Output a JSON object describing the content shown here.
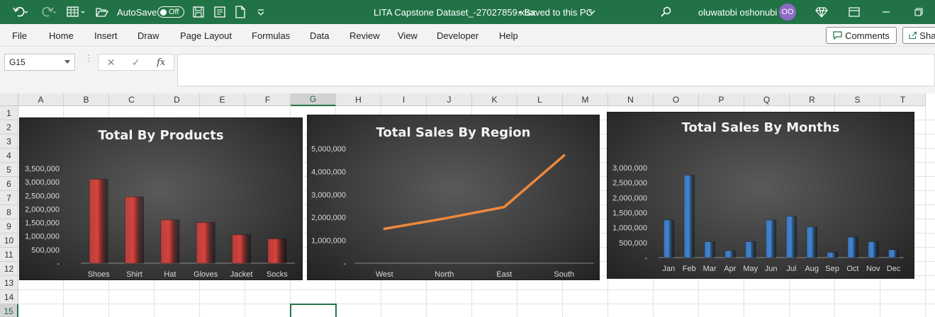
{
  "titlebar": {
    "autosave_label": "AutoSave",
    "autosave_state": "Off",
    "filename": "LITA Capstone Dataset_-27027859.xlsx",
    "save_status": "• Saved to this PC",
    "user_name": "oluwatobi oshonubi",
    "user_initials": "OO"
  },
  "ribbon": {
    "tabs": [
      "File",
      "Home",
      "Insert",
      "Draw",
      "Page Layout",
      "Formulas",
      "Data",
      "Review",
      "View",
      "Developer",
      "Help"
    ],
    "comments_label": "Comments",
    "share_label": "Share"
  },
  "formula_bar": {
    "name_box": "G15",
    "fx_label": "fx",
    "cancel_glyph": "✕",
    "enter_glyph": "✓",
    "value": ""
  },
  "grid": {
    "columns": [
      "A",
      "B",
      "C",
      "D",
      "E",
      "F",
      "G",
      "H",
      "I",
      "J",
      "K",
      "L",
      "M",
      "N",
      "O",
      "P",
      "Q",
      "R",
      "S",
      "T"
    ],
    "rows": [
      "1",
      "2",
      "3",
      "4",
      "5",
      "6",
      "7",
      "8",
      "9",
      "10",
      "11",
      "12",
      "13",
      "14",
      "15"
    ],
    "active_column": "G",
    "active_row": "15"
  },
  "chart_data": [
    {
      "type": "bar",
      "title": "Total By Products",
      "categories": [
        "Shoes",
        "Shirt",
        "Hat",
        "Gloves",
        "Jacket",
        "Socks"
      ],
      "values": [
        3100000,
        2450000,
        1600000,
        1500000,
        1050000,
        900000
      ],
      "ylim": [
        0,
        3500000
      ],
      "yticks": [
        "3,500,000",
        "3,000,000",
        "2,500,000",
        "2,000,000",
        "1,500,000",
        "1,000,000",
        "500,000",
        "-"
      ],
      "bar_color": "#d9413c",
      "grid": false,
      "legend": "none"
    },
    {
      "type": "line",
      "title": "Total Sales By Region",
      "categories": [
        "West",
        "North",
        "East",
        "South"
      ],
      "values": [
        1500000,
        1950000,
        2450000,
        4700000
      ],
      "ylim": [
        0,
        5000000
      ],
      "yticks": [
        "5,000,000",
        "4,000,000",
        "3,000,000",
        "2,000,000",
        "1,000,000",
        "-"
      ],
      "line_color": "#f0883a",
      "grid": false,
      "legend": "none"
    },
    {
      "type": "bar",
      "title": "Total Sales By Months",
      "categories": [
        "Jan",
        "Feb",
        "Mar",
        "Apr",
        "May",
        "Jun",
        "Jul",
        "Aug",
        "Sep",
        "Oct",
        "Nov",
        "Dec"
      ],
      "values": [
        1250000,
        2750000,
        530000,
        230000,
        530000,
        1250000,
        1380000,
        1020000,
        170000,
        680000,
        530000,
        260000
      ],
      "ylim": [
        0,
        3000000
      ],
      "yticks": [
        "3,000,000",
        "2,500,000",
        "2,000,000",
        "1,500,000",
        "1,000,000",
        "500,000",
        "-"
      ],
      "bar_color": "#3f86d8",
      "grid": false,
      "legend": "none"
    }
  ]
}
